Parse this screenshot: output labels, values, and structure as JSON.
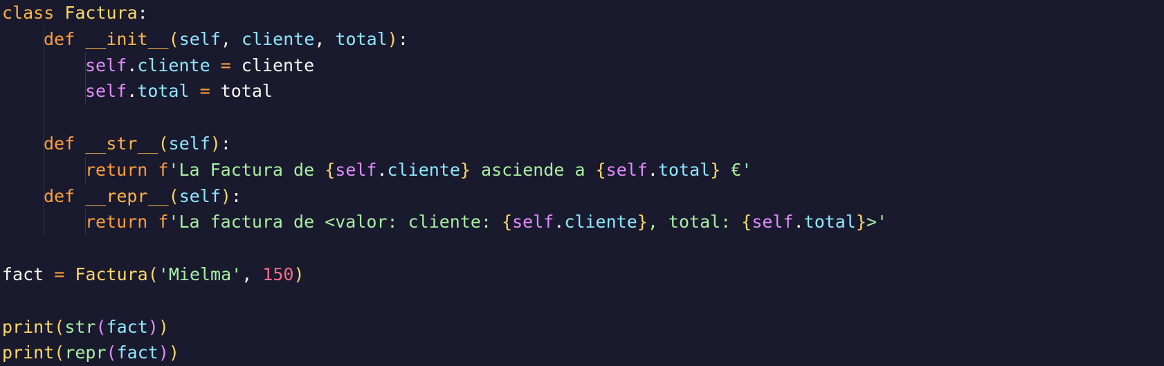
{
  "editor": {
    "lines": [
      {
        "tokens": [
          [
            "kw-class",
            "class "
          ],
          [
            "cls",
            "Factura"
          ],
          [
            "plain",
            ":"
          ]
        ]
      },
      {
        "indent": 1,
        "tokens": [
          [
            "kw-def",
            "def "
          ],
          [
            "fn",
            "__init__"
          ],
          [
            "paren",
            "("
          ],
          [
            "param",
            "self"
          ],
          [
            "plain",
            ", "
          ],
          [
            "param",
            "cliente"
          ],
          [
            "plain",
            ", "
          ],
          [
            "param",
            "total"
          ],
          [
            "paren",
            ")"
          ],
          [
            "plain",
            ":"
          ]
        ]
      },
      {
        "indent": 2,
        "tokens": [
          [
            "self",
            "self"
          ],
          [
            "plain",
            "."
          ],
          [
            "attr",
            "cliente"
          ],
          [
            "op",
            " = "
          ],
          [
            "plain",
            "cliente"
          ]
        ]
      },
      {
        "indent": 2,
        "tokens": [
          [
            "self",
            "self"
          ],
          [
            "plain",
            "."
          ],
          [
            "attr",
            "total"
          ],
          [
            "op",
            " = "
          ],
          [
            "plain",
            "total"
          ]
        ]
      },
      {
        "indent": 1,
        "tokens": []
      },
      {
        "indent": 1,
        "tokens": [
          [
            "kw-def",
            "def "
          ],
          [
            "fn",
            "__str__"
          ],
          [
            "paren",
            "("
          ],
          [
            "param",
            "self"
          ],
          [
            "paren",
            ")"
          ],
          [
            "plain",
            ":"
          ]
        ]
      },
      {
        "indent": 2,
        "tokens": [
          [
            "kw-def",
            "return "
          ],
          [
            "fprefix",
            "f"
          ],
          [
            "str",
            "'La Factura de "
          ],
          [
            "brace",
            "{"
          ],
          [
            "self",
            "self"
          ],
          [
            "plain",
            "."
          ],
          [
            "attr",
            "cliente"
          ],
          [
            "brace",
            "}"
          ],
          [
            "str",
            " asciende a "
          ],
          [
            "brace",
            "{"
          ],
          [
            "self",
            "self"
          ],
          [
            "plain",
            "."
          ],
          [
            "attr",
            "total"
          ],
          [
            "brace",
            "}"
          ],
          [
            "str",
            " €'"
          ]
        ]
      },
      {
        "indent": 1,
        "tokens": [
          [
            "kw-def",
            "def "
          ],
          [
            "fn",
            "__repr__"
          ],
          [
            "paren",
            "("
          ],
          [
            "param",
            "self"
          ],
          [
            "paren",
            ")"
          ],
          [
            "plain",
            ":"
          ]
        ]
      },
      {
        "indent": 2,
        "tokens": [
          [
            "kw-def",
            "return "
          ],
          [
            "fprefix",
            "f"
          ],
          [
            "str",
            "'La factura de <valor: cliente: "
          ],
          [
            "brace",
            "{"
          ],
          [
            "self",
            "self"
          ],
          [
            "plain",
            "."
          ],
          [
            "attr",
            "cliente"
          ],
          [
            "brace",
            "}"
          ],
          [
            "str",
            ", total: "
          ],
          [
            "brace",
            "{"
          ],
          [
            "self",
            "self"
          ],
          [
            "plain",
            "."
          ],
          [
            "attr",
            "total"
          ],
          [
            "brace",
            "}"
          ],
          [
            "str",
            ">'"
          ]
        ]
      },
      {
        "indent": 0,
        "tokens": []
      },
      {
        "indent": 0,
        "tokens": [
          [
            "plain",
            "fact"
          ],
          [
            "op",
            " = "
          ],
          [
            "cls",
            "Factura"
          ],
          [
            "paren",
            "("
          ],
          [
            "str",
            "'Mielma'"
          ],
          [
            "plain",
            ", "
          ],
          [
            "num",
            "150"
          ],
          [
            "paren",
            ")"
          ]
        ]
      },
      {
        "indent": 0,
        "tokens": []
      },
      {
        "indent": 0,
        "tokens": [
          [
            "builtin",
            "print"
          ],
          [
            "paren",
            "("
          ],
          [
            "builtin2",
            "str"
          ],
          [
            "paren2",
            "("
          ],
          [
            "param",
            "fact"
          ],
          [
            "paren2",
            ")"
          ],
          [
            "paren",
            ")"
          ]
        ]
      },
      {
        "indent": 0,
        "tokens": [
          [
            "builtin",
            "print"
          ],
          [
            "paren",
            "("
          ],
          [
            "builtin2",
            "repr"
          ],
          [
            "paren2",
            "("
          ],
          [
            "param",
            "fact"
          ],
          [
            "paren2",
            ")"
          ],
          [
            "paren",
            ")"
          ]
        ]
      }
    ]
  }
}
